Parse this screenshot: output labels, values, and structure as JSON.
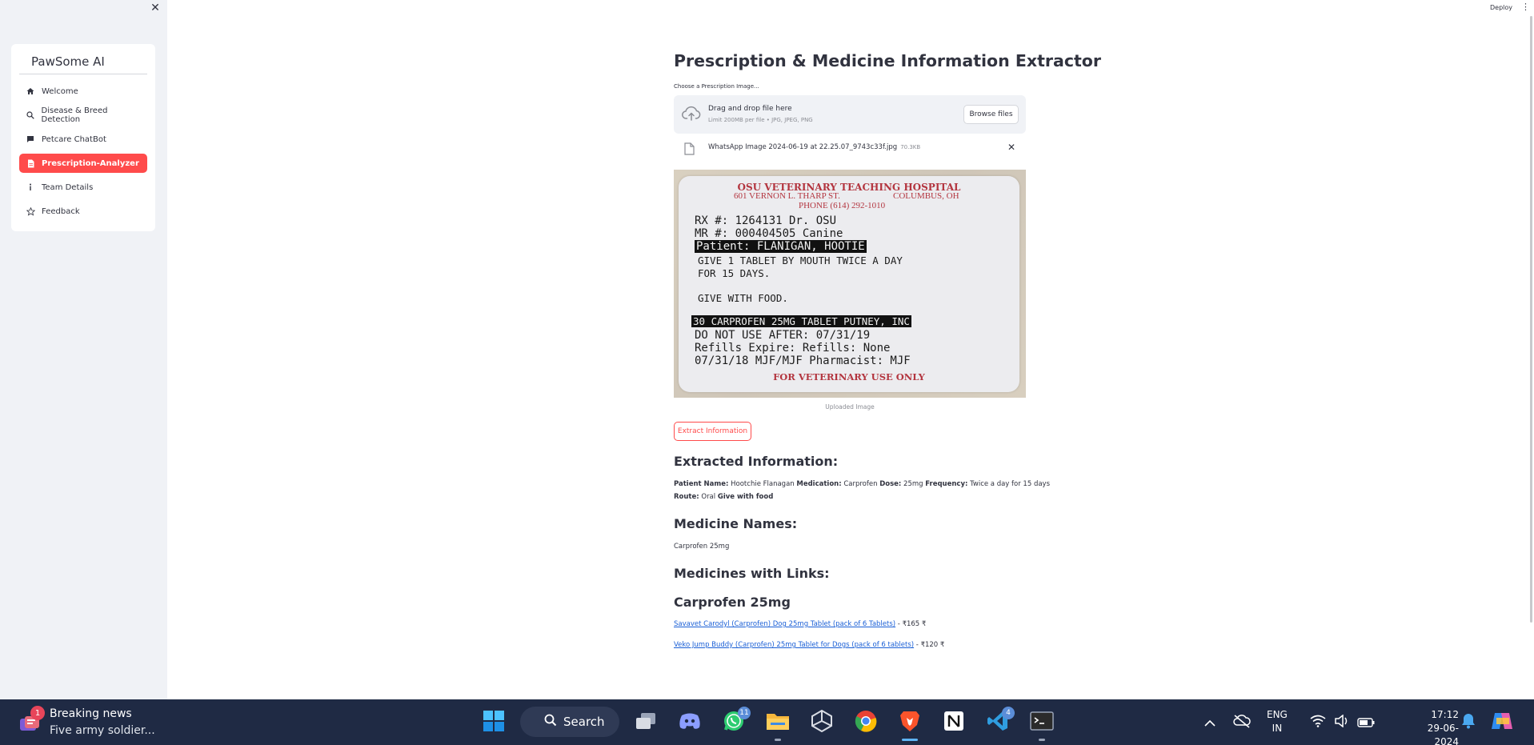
{
  "sidebar": {
    "close_glyph": "✕",
    "menu_title": "PawSome AI",
    "items": [
      {
        "label": "Welcome",
        "icon": "house-icon",
        "active": false
      },
      {
        "label": "Disease & Breed Detection",
        "icon": "search-icon",
        "active": false
      },
      {
        "label": "Petcare ChatBot",
        "icon": "chat-icon",
        "active": false
      },
      {
        "label": "Prescription-Analyzer",
        "icon": "document-icon",
        "active": true
      },
      {
        "label": "Team Details",
        "icon": "info-icon",
        "active": false
      },
      {
        "label": "Feedback",
        "icon": "star-icon",
        "active": false
      }
    ]
  },
  "topbar": {
    "deploy_label": "Deploy",
    "menu_glyph": "⋮"
  },
  "main": {
    "title": "Prescription & Medicine Information Extractor",
    "uploader_label": "Choose a Prescription Image...",
    "dropzone_title": "Drag and drop file here",
    "dropzone_limit": "Limit 200MB per file • JPG, JPEG, PNG",
    "browse_label": "Browse files",
    "file_name": "WhatsApp Image 2024-06-19 at 22.25.07_9743c33f.jpg",
    "file_size": "70.3KB",
    "remove_glyph": "✕",
    "image_caption": "Uploaded Image",
    "extract_label": "Extract Information",
    "extracted_heading": "Extracted Information:",
    "extracted": {
      "patient_key": "Patient Name:",
      "patient_val": "Hootchie Flanagan",
      "medication_key": "Medication:",
      "medication_val": "Carprofen",
      "dose_key": "Dose:",
      "dose_val": "25mg",
      "frequency_key": "Frequency:",
      "frequency_val": "Twice a day for 15 days",
      "route_key": "Route:",
      "route_val": "Oral",
      "food_key": "Give with food"
    },
    "medicine_names_heading": "Medicine Names:",
    "medicine_names": "Carprofen 25mg",
    "links_heading": "Medicines with Links:",
    "medicine_subheading": "Carprofen 25mg",
    "links": [
      {
        "text": "Savavet Carodyl (Carprofen) Dog 25mg Tablet (pack of 6 Tablets)",
        "price": " - ₹165 ₹"
      },
      {
        "text": "Veko Jump Buddy (Carprofen) 25mg Tablet for Dogs (pack of 6 tablets)",
        "price": " - ₹120 ₹"
      }
    ]
  },
  "prescription_label": {
    "hospital": "OSU VETERINARY TEACHING HOSPITAL",
    "address_left": "601 VERNON L. THARP ST.",
    "address_right": "COLUMBUS, OH",
    "phone": "PHONE (614) 292-1010",
    "rx_line": "RX #: 1264131  Dr. OSU",
    "mr_line": "MR #: 000404505   Canine",
    "patient_line": "Patient: FLANIGAN, HOOTIE",
    "give_line1": "GIVE 1 TABLET BY MOUTH TWICE A DAY",
    "give_line2": "FOR 15 DAYS.",
    "food_line": "GIVE WITH FOOD.",
    "drug_line": "30  CARPROFEN 25MG TABLET  PUTNEY, INC",
    "expiry_line": "DO NOT USE AFTER: 07/31/19",
    "refills_line": "Refills Expire:    Refills: None",
    "date_line": " 07/31/18  MJF/MJF  Pharmacist: MJF",
    "footer": "FOR VETERINARY USE ONLY"
  },
  "taskbar": {
    "news_badge": "1",
    "news_title": "Breaking news",
    "news_text": "Five army soldier...",
    "search_label": "Search",
    "whatsapp_badge": "11",
    "vscode_badge": "4",
    "lang_top": "ENG",
    "lang_bottom": "IN",
    "time": "17:12",
    "date": "29-06-2024"
  },
  "colors": {
    "accent": "#ff4b4b",
    "sidebar_bg": "#f0f2f6",
    "link": "#1a5fd6",
    "taskbar_bg": "#1f2a44"
  }
}
